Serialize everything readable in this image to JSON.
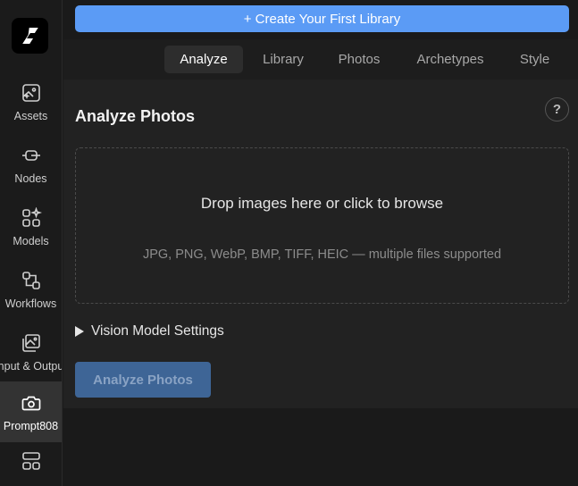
{
  "sidebar": {
    "items": [
      {
        "label": "Assets"
      },
      {
        "label": "Nodes"
      },
      {
        "label": "Models"
      },
      {
        "label": "Workflows"
      },
      {
        "label": "Input & Output"
      },
      {
        "label": "Prompt808"
      },
      {
        "label": ""
      }
    ]
  },
  "header": {
    "create_label": "+ Create Your First Library"
  },
  "tabs": [
    {
      "label": "Analyze"
    },
    {
      "label": "Library"
    },
    {
      "label": "Photos"
    },
    {
      "label": "Archetypes"
    },
    {
      "label": "Style"
    }
  ],
  "panel": {
    "title": "Analyze Photos",
    "help": "?",
    "drop_main": "Drop images here or click to browse",
    "drop_sub": "JPG, PNG, WebP, BMP, TIFF, HEIC — multiple files supported",
    "settings_label": "Vision Model Settings",
    "analyze_label": "Analyze Photos"
  },
  "colors": {
    "accent": "#5b9bf5",
    "analyze_disabled": "#3e6596"
  }
}
